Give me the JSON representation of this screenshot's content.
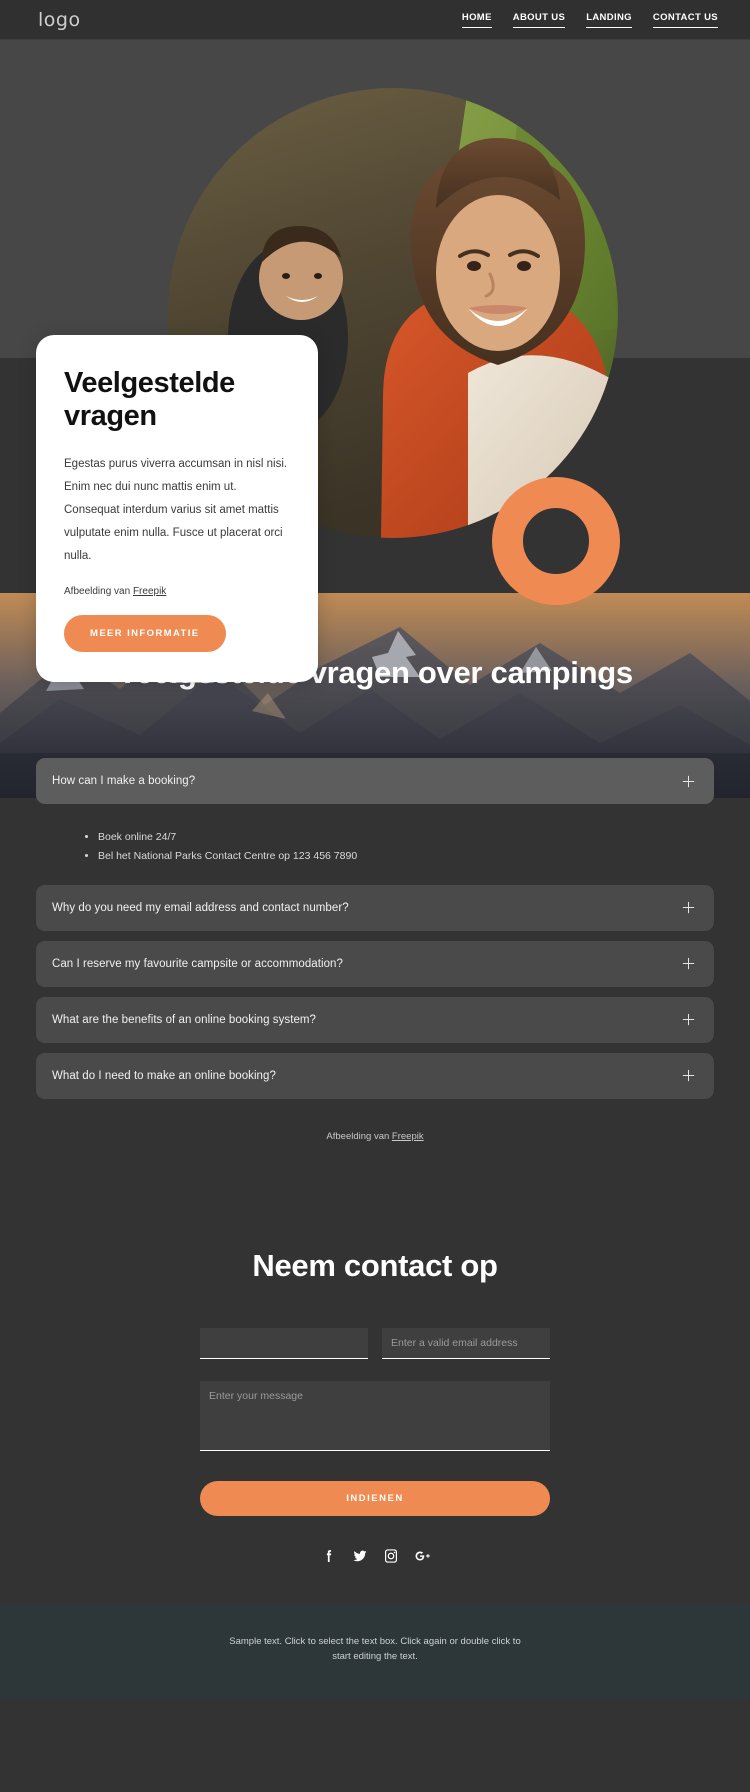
{
  "header": {
    "logo": "logo",
    "nav": [
      {
        "label": "HOME"
      },
      {
        "label": "ABOUT US"
      },
      {
        "label": "LANDING"
      },
      {
        "label": "CONTACT US"
      }
    ]
  },
  "hero": {
    "card": {
      "title": "Veelgestelde vragen",
      "body": "Egestas purus viverra accumsan in nisl nisi. Enim nec dui nunc mattis enim ut. Consequat interdum varius sit amet mattis vulputate enim nulla. Fusce ut placerat orci nulla.",
      "credit_prefix": "Afbeelding van ",
      "credit_link": "Freepik",
      "button": "MEER INFORMATIE"
    },
    "accent_color": "#ef8b52"
  },
  "faq": {
    "heading": "Veelgestelde vragen over campings",
    "items": [
      {
        "question": "How can I make a booking?",
        "expanded": true,
        "answers": [
          "Boek online 24/7",
          "Bel het National Parks Contact Centre op 123 456 7890"
        ]
      },
      {
        "question": "Why do you need my email address and contact number?",
        "expanded": false,
        "answers": []
      },
      {
        "question": "Can I reserve my favourite campsite or accommodation?",
        "expanded": false,
        "answers": []
      },
      {
        "question": "What are the benefits of an online booking system?",
        "expanded": false,
        "answers": []
      },
      {
        "question": "What do I need to make an online booking?",
        "expanded": false,
        "answers": []
      }
    ],
    "credit_prefix": "Afbeelding van ",
    "credit_link": "Freepik"
  },
  "contact": {
    "title": "Neem contact op",
    "name_value": "",
    "name_placeholder": "",
    "email_placeholder": "Enter a valid email address",
    "email_value": "",
    "message_placeholder": "Enter your message",
    "message_value": "",
    "submit_label": "INDIENEN",
    "socials": [
      {
        "name": "facebook"
      },
      {
        "name": "twitter"
      },
      {
        "name": "instagram"
      },
      {
        "name": "google-plus"
      }
    ]
  },
  "footer": {
    "text": "Sample text. Click to select the text box. Click again or double click to start editing the text."
  }
}
